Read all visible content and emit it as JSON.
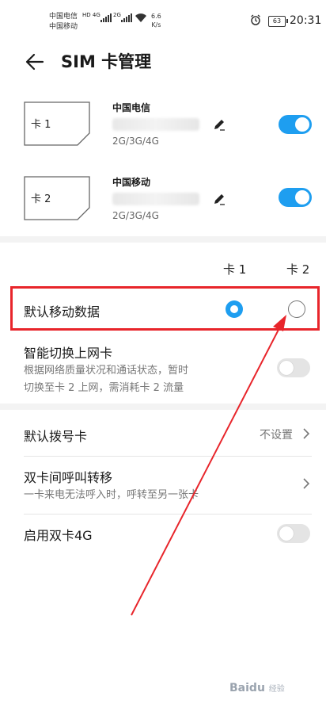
{
  "status_bar": {
    "carrier1": "中国电信",
    "carrier2": "中国移动",
    "net_badge1": "HD 4G",
    "net_badge2": "2G",
    "speed_value": "6.6",
    "speed_unit": "K/s",
    "battery": "63",
    "time": "20:31"
  },
  "header": {
    "title": "SIM 卡管理"
  },
  "sims": [
    {
      "card_label": "卡 1",
      "carrier": "中国电信",
      "network_types": "2G/3G/4G",
      "enabled": true
    },
    {
      "card_label": "卡 2",
      "carrier": "中国移动",
      "network_types": "2G/3G/4G",
      "enabled": true
    }
  ],
  "columns": {
    "card1": "卡 1",
    "card2": "卡 2"
  },
  "default_data": {
    "label": "默认移动数据",
    "selected": "card1"
  },
  "smart_switch": {
    "title": "智能切换上网卡",
    "desc_line1": "根据网络质量状况和通话状态，暂时",
    "desc_line2": "切换至卡 2 上网，需消耗卡 2 流量",
    "enabled": false
  },
  "default_dial": {
    "title": "默认拨号卡",
    "value": "不设置"
  },
  "call_forward": {
    "title": "双卡间呼叫转移",
    "desc": "一卡来电无法呼入时，呼转至另一张卡"
  },
  "dual_4g": {
    "title": "启用双卡4G",
    "enabled": false
  },
  "watermark": {
    "brand": "Baidu",
    "suffix": "经验"
  },
  "colors": {
    "accent": "#1e9ef0",
    "annotation": "#e8252b"
  }
}
